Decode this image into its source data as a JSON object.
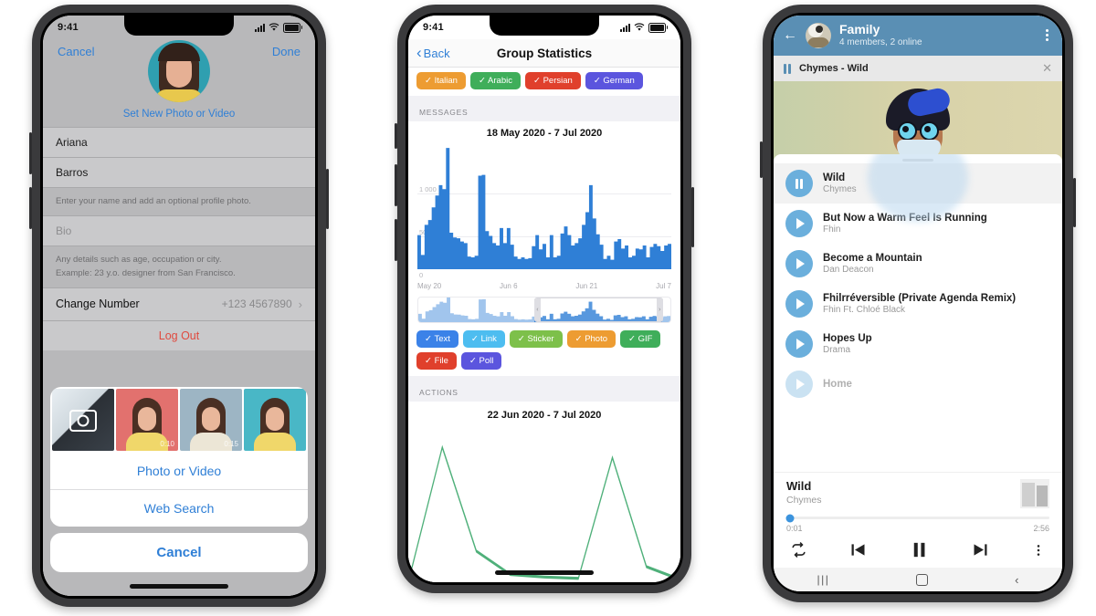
{
  "phone1": {
    "status": {
      "time": "9:41"
    },
    "nav": {
      "cancel": "Cancel",
      "done": "Done"
    },
    "set_photo_label": "Set New Photo or Video",
    "first_name": "Ariana",
    "last_name": "Barros",
    "name_hint": "Enter your name and add an optional profile photo.",
    "bio_placeholder": "Bio",
    "bio_hint_line1": "Any details such as age, occupation or city.",
    "bio_hint_line2": "Example: 23 y.o. designer from San Francisco.",
    "change_number_label": "Change Number",
    "change_number_value": "+123 4567890",
    "logout_label": "Log Out",
    "sheet": {
      "photo_or_video": "Photo or Video",
      "web_search": "Web Search",
      "cancel": "Cancel",
      "thumbs": [
        {
          "name": "camera-tile",
          "duration": ""
        },
        {
          "name": "photo-1",
          "duration": "0:10"
        },
        {
          "name": "photo-2",
          "duration": "0:15"
        },
        {
          "name": "photo-3",
          "duration": ""
        }
      ]
    }
  },
  "phone2": {
    "status": {
      "time": "9:41"
    },
    "nav": {
      "back": "Back",
      "title": "Group Statistics"
    },
    "language_tags": [
      {
        "label": "Italian",
        "color": "#ed9c32"
      },
      {
        "label": "Arabic",
        "color": "#3fae5a"
      },
      {
        "label": "Persian",
        "color": "#e0402c"
      },
      {
        "label": "German",
        "color": "#5b55de"
      }
    ],
    "messages_section": "MESSAGES",
    "actions_section": "ACTIONS",
    "messages_range": "18 May 2020 - 7 Jul 2020",
    "actions_range": "22 Jun 2020 - 7 Jul 2020",
    "type_tags": [
      {
        "label": "Text",
        "color": "#3b82e8"
      },
      {
        "label": "Link",
        "color": "#4dbdf0"
      },
      {
        "label": "Sticker",
        "color": "#7dc04a"
      },
      {
        "label": "Photo",
        "color": "#ed9c32"
      },
      {
        "label": "GIF",
        "color": "#3fae5a"
      },
      {
        "label": "File",
        "color": "#e0402c"
      },
      {
        "label": "Poll",
        "color": "#5b55de"
      }
    ],
    "accent": "#2f7fd6"
  },
  "phone3": {
    "header": {
      "title": "Family",
      "subtitle": "4 members, 2 online",
      "color": "#5a8fb4"
    },
    "now_playing_bar": {
      "label": "Chymes - Wild"
    },
    "playlist": [
      {
        "title": "Wild",
        "artist": "Chymes",
        "state": "playing"
      },
      {
        "title": "But Now a Warm Feel Is Running",
        "artist": "Fhin",
        "state": "paused"
      },
      {
        "title": "Become a Mountain",
        "artist": "Dan Deacon",
        "state": "paused"
      },
      {
        "title": "Fhilrréversible (Private Agenda Remix)",
        "artist": "Fhin Ft. Chloé Black",
        "state": "paused"
      },
      {
        "title": "Hopes Up",
        "artist": "Drama",
        "state": "paused"
      },
      {
        "title": "Home",
        "artist": "",
        "state": "paused"
      }
    ],
    "player": {
      "title": "Wild",
      "artist": "Chymes",
      "elapsed": "0:01",
      "duration": "2:56",
      "progress_percent": 1.5,
      "accent": "#3b93dd"
    }
  },
  "chart_data": [
    {
      "type": "bar",
      "title": "18 May 2020 - 7 Jul 2020",
      "section": "MESSAGES",
      "xlabel": "",
      "ylabel": "",
      "ylim": [
        0,
        1600
      ],
      "grid": true,
      "ytick_labels": [
        "1 000",
        "500",
        "0"
      ],
      "ytick_values": [
        1000,
        500,
        0
      ],
      "xtick_labels": [
        "May 20",
        "Jun 6",
        "Jun 21",
        "Jul 7"
      ],
      "legend": "none",
      "color": "#2f7fd6",
      "values": [
        430,
        180,
        560,
        620,
        780,
        930,
        1060,
        1010,
        1530,
        460,
        400,
        390,
        350,
        330,
        160,
        150,
        170,
        1180,
        1190,
        480,
        420,
        330,
        300,
        520,
        330,
        520,
        310,
        160,
        130,
        150,
        130,
        140,
        290,
        430,
        250,
        320,
        150,
        430,
        150,
        170,
        450,
        540,
        430,
        300,
        330,
        390,
        560,
        720,
        1060,
        640,
        440,
        310,
        130,
        170,
        120,
        350,
        380,
        260,
        300,
        150,
        170,
        260,
        250,
        300,
        150,
        280,
        320,
        290,
        230,
        300,
        320
      ]
    },
    {
      "type": "bar",
      "title": "22 Jun 2020 - 7 Jul 2020",
      "section": "ACTIONS",
      "color": "#4fb07a",
      "values": [
        0,
        520,
        120,
        30,
        20,
        15,
        480,
        60,
        10
      ]
    }
  ]
}
